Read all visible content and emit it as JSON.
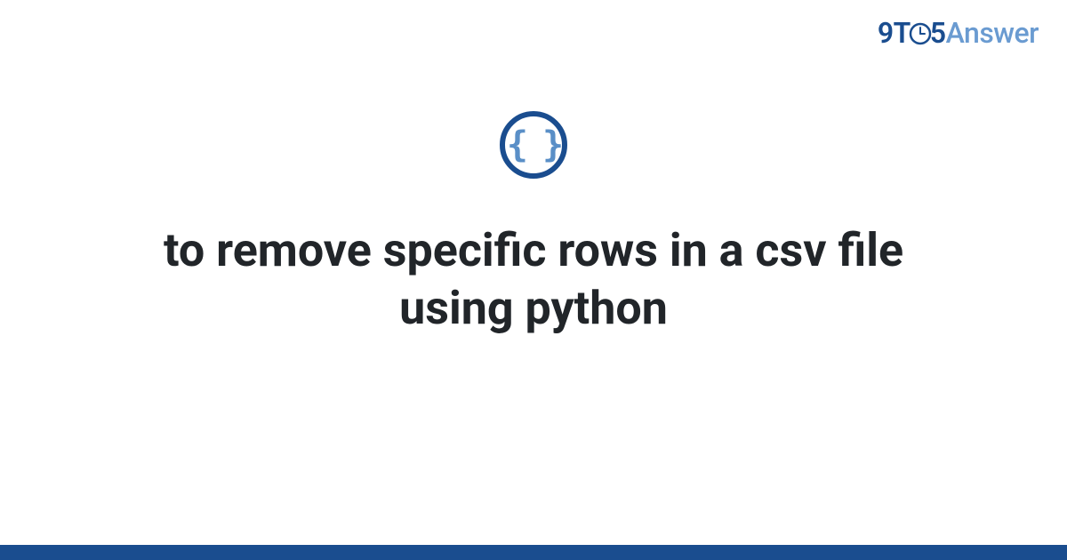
{
  "header": {
    "logo": {
      "prefix": "9T",
      "middle": "5",
      "suffix": "Answer"
    }
  },
  "main": {
    "icon_name": "code-braces-icon",
    "braces_glyph": "{ }",
    "title": "to remove specific rows in a csv file using python"
  },
  "colors": {
    "brand_dark": "#1a4d8f",
    "brand_light": "#6a9bd1",
    "icon_brace": "#5a8fc7",
    "text": "#212529"
  }
}
